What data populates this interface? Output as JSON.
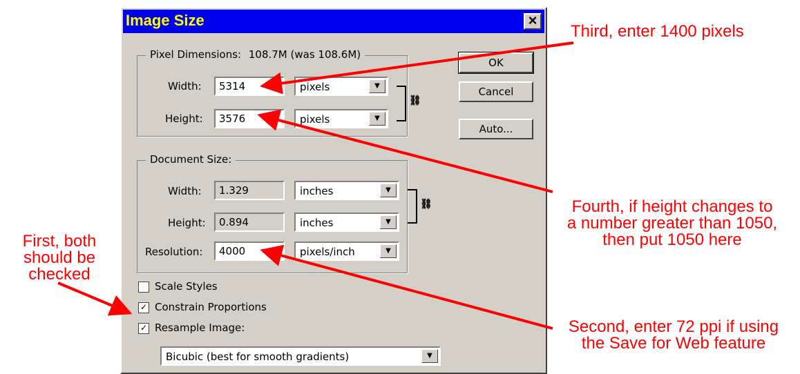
{
  "dialog": {
    "title": "Image Size",
    "close_glyph": "×",
    "pixel_dimensions": {
      "legend_label": "Pixel Dimensions:",
      "legend_value": "108.7M (was 108.6M)",
      "width_label": "Width:",
      "width_value": "5314",
      "width_unit": "pixels",
      "height_label": "Height:",
      "height_value": "3576",
      "height_unit": "pixels"
    },
    "document_size": {
      "legend": "Document Size:",
      "width_label": "Width:",
      "width_value": "1.329",
      "width_unit": "inches",
      "height_label": "Height:",
      "height_value": "0.894",
      "height_unit": "inches",
      "resolution_label": "Resolution:",
      "resolution_value": "4000",
      "resolution_unit": "pixels/inch"
    },
    "buttons": {
      "ok": "OK",
      "cancel": "Cancel",
      "auto": "Auto..."
    },
    "checkboxes": {
      "scale_styles": {
        "label": "Scale Styles",
        "checked": false
      },
      "constrain_proportions": {
        "label": "Constrain Proportions",
        "checked": true
      },
      "resample_image": {
        "label": "Resample Image:",
        "checked": true
      }
    },
    "resample_method": "Bicubic (best for smooth gradients)",
    "colors": {
      "title_bg": "#0000f0",
      "title_text": "#ffff00",
      "dialog_bg": "#d4d0c8"
    }
  },
  "annotations": {
    "third": "Third, enter 1400 pixels",
    "fourth_1": "Fourth, if height changes to",
    "fourth_2": "a number greater than 1050,",
    "fourth_3": "then put 1050 here",
    "first_1": "First, both",
    "first_2": "should be",
    "first_3": "checked",
    "second_1": "Second, enter 72 ppi if using",
    "second_2": "the Save for Web feature",
    "color": "#ff0000"
  }
}
